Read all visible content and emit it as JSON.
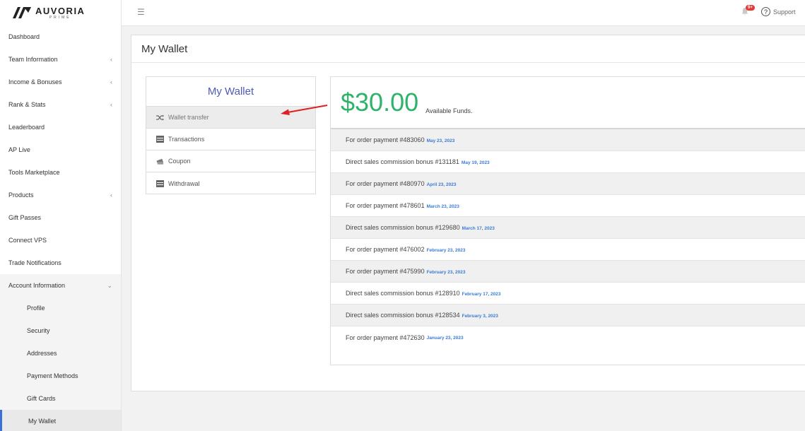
{
  "brand": {
    "name": "AUVORIA",
    "sub": "PRIME"
  },
  "sidebar": {
    "items": [
      {
        "label": "Dashboard",
        "chevron": ""
      },
      {
        "label": "Team Information",
        "chevron": "‹"
      },
      {
        "label": "Income & Bonuses",
        "chevron": "‹"
      },
      {
        "label": "Rank & Stats",
        "chevron": "‹"
      },
      {
        "label": "Leaderboard",
        "chevron": ""
      },
      {
        "label": "AP Live",
        "chevron": ""
      },
      {
        "label": "Tools Marketplace",
        "chevron": ""
      },
      {
        "label": "Products",
        "chevron": "‹"
      },
      {
        "label": "Gift Passes",
        "chevron": ""
      },
      {
        "label": "Connect VPS",
        "chevron": ""
      },
      {
        "label": "Trade Notifications",
        "chevron": ""
      },
      {
        "label": "Account Information",
        "chevron": "⌄"
      }
    ],
    "sub_items": [
      {
        "label": "Profile"
      },
      {
        "label": "Security"
      },
      {
        "label": "Addresses"
      },
      {
        "label": "Payment Methods"
      },
      {
        "label": "Gift Cards"
      },
      {
        "label": "My Wallet"
      }
    ]
  },
  "topbar": {
    "hamburger": "☰",
    "notif_badge": "9+",
    "support_label": "Support",
    "help_glyph": "?"
  },
  "page": {
    "title": "My Wallet"
  },
  "wallet_menu": {
    "title": "My Wallet",
    "items": [
      {
        "label": "Wallet transfer",
        "icon": "shuffle-icon"
      },
      {
        "label": "Transactions",
        "icon": "list-icon"
      },
      {
        "label": "Coupon",
        "icon": "coupon-icon"
      },
      {
        "label": "Withdrawal",
        "icon": "list-icon"
      }
    ]
  },
  "funds": {
    "amount": "$30.00",
    "label": "Available Funds."
  },
  "transactions": [
    {
      "text": "For order payment #483060",
      "date": "May 23, 2023"
    },
    {
      "text": "Direct sales commission bonus #131181",
      "date": "May 19, 2023"
    },
    {
      "text": "For order payment #480970",
      "date": "April 23, 2023"
    },
    {
      "text": "For order payment #478601",
      "date": "March 23, 2023"
    },
    {
      "text": "Direct sales commission bonus #129680",
      "date": "March 17, 2023"
    },
    {
      "text": "For order payment #476002",
      "date": "February 23, 2023"
    },
    {
      "text": "For order payment #475990",
      "date": "February 23, 2023"
    },
    {
      "text": "Direct sales commission bonus #128910",
      "date": "February 17, 2023"
    },
    {
      "text": "Direct sales commission bonus #128534",
      "date": "February 3, 2023"
    },
    {
      "text": "For order payment #472630",
      "date": "January 23, 2023"
    }
  ],
  "colors": {
    "accent": "#3a6fd8",
    "funds_green": "#2fb36a",
    "menu_title": "#4e5bb8",
    "date_blue": "#3a7bd5",
    "badge_red": "#e53935",
    "arrow_red": "#e02020"
  }
}
